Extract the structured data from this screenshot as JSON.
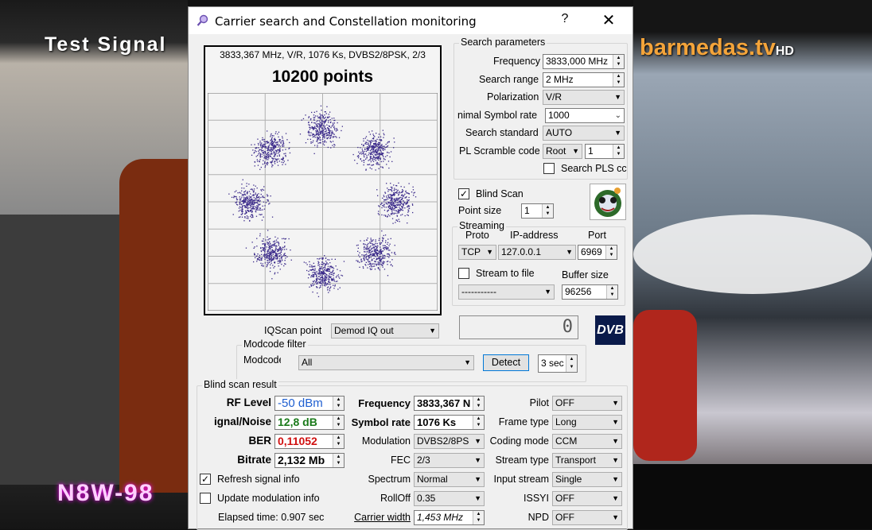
{
  "background": {
    "left_caption": "Test Signal",
    "ticker_text": "N8W-98",
    "right_logo": "barmedas.tv",
    "right_logo_suffix": "HD"
  },
  "window": {
    "title": "Carrier search and Constellation monitoring",
    "help": "?",
    "close": "✕"
  },
  "constellation": {
    "info": "3833,367 MHz, V/R, 1076 Ks, DVBS2/8PSK, 2/3",
    "points_label": "10200 points",
    "point_color": "#3b2a8a",
    "modulation": "8PSK",
    "grid_divisions": 8
  },
  "search_params": {
    "group_title": "Search parameters",
    "frequency_label": "Frequency",
    "frequency_value": "3833,000 MHz",
    "range_label": "Search range",
    "range_value": "2 MHz",
    "polarization_label": "Polarization",
    "polarization_value": "V/R",
    "min_sr_label": "nimal Symbol rate",
    "min_sr_value": "1000",
    "standard_label": "Search standard",
    "standard_value": "AUTO",
    "pl_label": "PL Scramble code",
    "pl_mode": "Root",
    "pl_value": "1",
    "search_pls_label": "Search PLS cc"
  },
  "blind": {
    "label": "Blind Scan",
    "checked": true,
    "point_size_label": "Point size",
    "point_size_value": "1"
  },
  "streaming": {
    "group_title": "Streaming",
    "proto_label": "Proto",
    "ip_label": "IP-address",
    "port_label": "Port",
    "proto_value": "TCP",
    "ip_value": "127.0.0.1",
    "port_value": "6969",
    "to_file_label": "Stream to file",
    "file_value": "-----------",
    "buffer_label": "Buffer size",
    "buffer_value": "96256"
  },
  "iq": {
    "label": "IQScan point",
    "value": "Demod IQ out"
  },
  "display_box_value": "0",
  "dvb_logo": "DVB",
  "modcode": {
    "group_title": "Modcode filter",
    "label": "Modcode",
    "value": "All",
    "detect_button": "Detect",
    "seconds_value": "3 sec"
  },
  "result": {
    "group_title": "Blind scan result",
    "rf_label": "RF Level",
    "rf_value": "-50 dBm",
    "rf_color": "#1f5fd0",
    "snr_label": "ignal/Noise",
    "snr_value": "12,8 dB",
    "snr_color": "#1a7a1a",
    "ber_label": "BER",
    "ber_value": "0,11052",
    "ber_color": "#d01010",
    "bitrate_label": "Bitrate",
    "bitrate_value": "2,132 Mb",
    "freq_label": "Frequency",
    "freq_value": "3833,367 N",
    "sr_label": "Symbol rate",
    "sr_value": "1076 Ks",
    "modulation_label": "Modulation",
    "modulation_value": "DVBS2/8PS",
    "fec_label": "FEC",
    "fec_value": "2/3",
    "spectrum_label": "Spectrum",
    "spectrum_value": "Normal",
    "rolloff_label": "RollOff",
    "rolloff_value": "0.35",
    "carrier_label": "Carrier width",
    "carrier_value": "1,453 MHz",
    "pilot_label": "Pilot",
    "pilot_value": "OFF",
    "frame_label": "Frame type",
    "frame_value": "Long",
    "coding_label": "Coding mode",
    "coding_value": "CCM",
    "stream_type_label": "Stream type",
    "stream_type_value": "Transport",
    "input_stream_label": "Input stream",
    "input_stream_value": "Single",
    "issyi_label": "ISSYI",
    "issyi_value": "OFF",
    "npd_label": "NPD",
    "npd_value": "OFF",
    "refresh_label": "Refresh signal info",
    "refresh_checked": true,
    "update_label": "Update modulation info",
    "update_checked": false,
    "elapsed": "Elapsed time: 0.907 sec"
  }
}
